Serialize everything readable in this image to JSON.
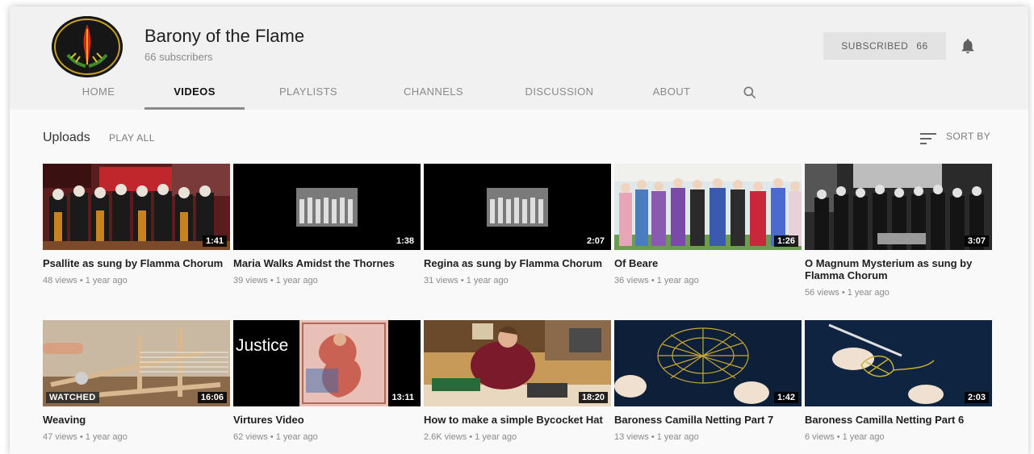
{
  "channel": {
    "name": "Barony of the Flame",
    "subscribers": "66 subscribers",
    "subscribe_label": "SUBSCRIBED",
    "subscribe_count": "66"
  },
  "tabs": [
    {
      "label": "HOME"
    },
    {
      "label": "VIDEOS"
    },
    {
      "label": "PLAYLISTS"
    },
    {
      "label": "CHANNELS"
    },
    {
      "label": "DISCUSSION"
    },
    {
      "label": "ABOUT"
    }
  ],
  "section": {
    "title": "Uploads",
    "play_all": "PLAY ALL",
    "sort_by": "SORT BY"
  },
  "videos": [
    {
      "title": "Psallite as sung by Flamma Chorum",
      "duration": "1:41",
      "meta": "48 views • 1 year ago"
    },
    {
      "title": "Maria Walks Amidst the Thornes",
      "duration": "1:38",
      "meta": "39 views • 1 year ago"
    },
    {
      "title": "Regina as sung by Flamma Chorum",
      "duration": "2:07",
      "meta": "31 views • 1 year ago"
    },
    {
      "title": "Of Beare",
      "duration": "1:26",
      "meta": "36 views • 1 year ago"
    },
    {
      "title": "O Magnum Mysterium as sung by Flamma Chorum",
      "duration": "3:07",
      "meta": "56 views • 1 year ago"
    },
    {
      "title": "Weaving",
      "duration": "16:06",
      "meta": "47 views • 1 year ago",
      "watched": "WATCHED"
    },
    {
      "title": "Virtures Video",
      "duration": "13:11",
      "meta": "62 views • 1 year ago",
      "overlay_text": "Justice"
    },
    {
      "title": "How to make a simple Bycocket Hat",
      "duration": "18:20",
      "meta": "2.6K views • 1 year ago"
    },
    {
      "title": "Baroness Camilla Netting Part 7",
      "duration": "1:42",
      "meta": "13 views • 1 year ago"
    },
    {
      "title": "Baroness Camilla Netting Part 6",
      "duration": "2:03",
      "meta": "6 views • 1 year ago"
    }
  ],
  "icons": {
    "bell": "bell-icon",
    "search": "search-icon",
    "sort": "sort-icon"
  }
}
